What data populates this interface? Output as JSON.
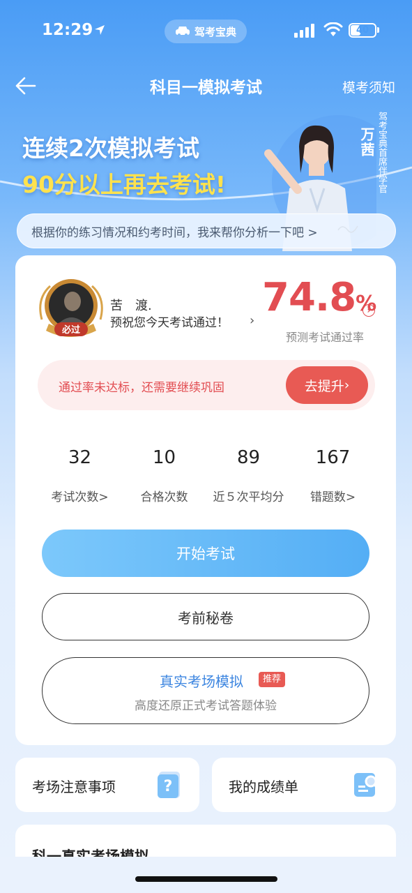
{
  "status_bar": {
    "time": "12:29",
    "app_name": "驾考宝典",
    "battery": "40",
    "battery_level": 0.4
  },
  "nav": {
    "title": "科目一模拟考试",
    "right_link": "模考须知"
  },
  "banner": {
    "line1": "连续2次模拟考试",
    "line2": "90分以上再去考试!",
    "presenter_name": "万茜",
    "presenter_title": "驾考宝典首席伴学官",
    "analysis_prompt": "根据你的练习情况和约考时间，我来帮你分析一下吧 >"
  },
  "profile": {
    "badge": "必过",
    "user_name": "苦　渡.",
    "blessing": "预祝您今天考试通过！",
    "pass_rate_value": "74.8",
    "pass_rate_unit": "%",
    "pass_rate_label": "预测考试通过率"
  },
  "warning": {
    "text": "通过率未达标，还需要继续巩固",
    "button": "去提升"
  },
  "stats": [
    {
      "value": "32",
      "label": "考试次数>"
    },
    {
      "value": "10",
      "label": "合格次数"
    },
    {
      "value": "89",
      "label": "近５次平均分"
    },
    {
      "value": "167",
      "label": "错题数>"
    }
  ],
  "actions": {
    "start": "开始考试",
    "secret": "考前秘卷",
    "real_title": "真实考场模拟",
    "real_tag": "推荐",
    "real_sub": "高度还原正式考试答题体验"
  },
  "tiles": {
    "notice": "考场注意事项",
    "score": "我的成绩单",
    "partial": "科一真实考场模拟"
  },
  "colors": {
    "accent_red": "#e24d52",
    "accent_blue": "#54aef5",
    "banner_yellow": "#ffe24d"
  }
}
